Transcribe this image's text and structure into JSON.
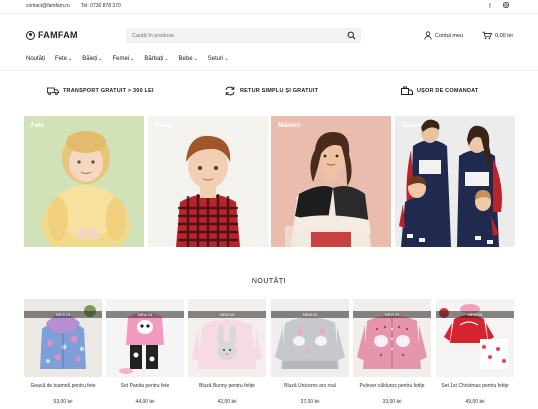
{
  "topbar": {
    "email": "contact@famfam.ro",
    "phone": "Tel: 0736 878 370",
    "social": [
      "facebook-icon",
      "instagram-icon"
    ]
  },
  "header": {
    "logo": "FAMFAM",
    "search_placeholder": "Caută în produse",
    "account_label": "Contul meu",
    "cart_label": "0,00 lei"
  },
  "nav": {
    "items": [
      {
        "label": "Noutăți",
        "dropdown": false
      },
      {
        "label": "Fete",
        "dropdown": true
      },
      {
        "label": "Băieți",
        "dropdown": true
      },
      {
        "label": "Femei",
        "dropdown": true
      },
      {
        "label": "Bărbați",
        "dropdown": true
      },
      {
        "label": "Bebe",
        "dropdown": true
      },
      {
        "label": "Seturi",
        "dropdown": true
      }
    ]
  },
  "benefits": [
    {
      "label": "TRANSPORT GRATUIT > 300 LEI",
      "icon": "truck-icon"
    },
    {
      "label": "RETUR SIMPLU ȘI GRATUIT",
      "icon": "return-icon"
    },
    {
      "label": "UȘOR DE COMANDAT",
      "icon": "order-icon"
    }
  ],
  "categories": [
    {
      "label": "Fete"
    },
    {
      "label": "Băieți"
    },
    {
      "label": "Mămici"
    },
    {
      "label": "Seturi"
    }
  ],
  "section_title": "NOUTĂȚI",
  "products": [
    {
      "badge": "NEW IN",
      "name": "Geacă de toamnă pentru fete",
      "price": "53,00 lei"
    },
    {
      "badge": "NEW IN",
      "name": "Set Panda pentru fete",
      "price": "44,00 lei"
    },
    {
      "badge": "NEW IN",
      "name": "Bluză Bunny pentru fetițe",
      "price": "42,00 lei"
    },
    {
      "badge": "NEW IN",
      "name": "Bluză Unicorns ars roal",
      "price": "37,00 lei"
    },
    {
      "badge": "NEW IN",
      "name": "Pulover călduros pentru fetițe",
      "price": "33,00 lei"
    },
    {
      "badge": "NEW IN",
      "name": "Set 1st Christmas pentru fetițe",
      "price": "49,00 lei"
    }
  ],
  "colors": {
    "accent": "#222222",
    "badge_bg": "#3a3a3a"
  }
}
